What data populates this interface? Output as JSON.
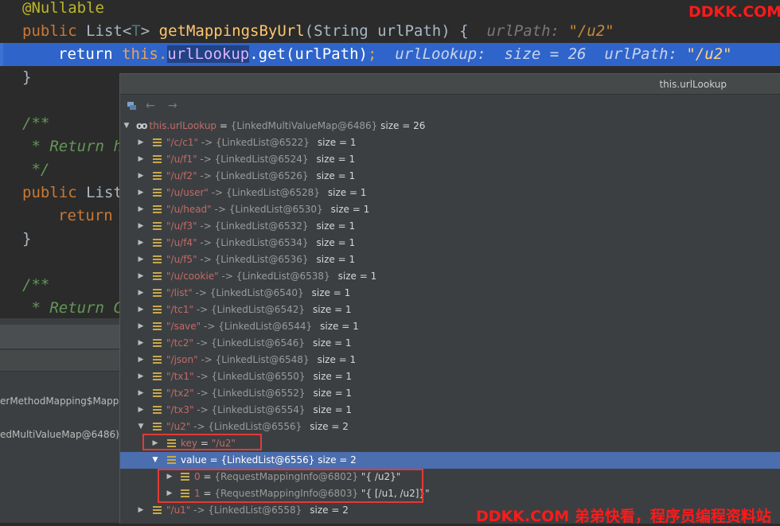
{
  "editor": {
    "line1": "@Nullable",
    "line2": {
      "public": "public ",
      "type": "List<",
      "tparam": "T",
      "close": "> ",
      "method": "getMappingsByUrl",
      "params": "(String urlPath) {  ",
      "hint_label": "urlPath: ",
      "hint_value": "\"/u2\""
    },
    "line3": {
      "ret": "return ",
      "this": "this.",
      "field": "urlLookup",
      "rest": ".get(urlPath)",
      "semi": ";  ",
      "hint1": "urlLookup:  size = 26  ",
      "hint2_label": "urlPath: ",
      "hint2_value": "\"/u2\""
    },
    "line4": "}",
    "line6": "/**",
    "line7": " * Return h",
    "line8": " */",
    "line9": {
      "public": "public ",
      "type": "List"
    },
    "line10": "return",
    "line11": "}",
    "line13": "/**",
    "line14": " * Return C"
  },
  "debug_frames": [
    "erMethodMapping$Mapp",
    "edMultiValueMap@6486)"
  ],
  "popup": {
    "title": "this.urlLookup",
    "toolbar": {
      "back": "←",
      "forward": "→"
    },
    "root": {
      "name": "this.urlLookup",
      "eq": " = ",
      "ref": "{LinkedMultiValueMap@6486}",
      "size": "  size = 26"
    },
    "entries": [
      {
        "key": "\"/c/c1\"",
        "ref": "{LinkedList@6522}",
        "size": "size = 1"
      },
      {
        "key": "\"/u/f1\"",
        "ref": "{LinkedList@6524}",
        "size": "size = 1"
      },
      {
        "key": "\"/u/f2\"",
        "ref": "{LinkedList@6526}",
        "size": "size = 1"
      },
      {
        "key": "\"/u/user\"",
        "ref": "{LinkedList@6528}",
        "size": "size = 1"
      },
      {
        "key": "\"/u/head\"",
        "ref": "{LinkedList@6530}",
        "size": "size = 1"
      },
      {
        "key": "\"/u/f3\"",
        "ref": "{LinkedList@6532}",
        "size": "size = 1"
      },
      {
        "key": "\"/u/f4\"",
        "ref": "{LinkedList@6534}",
        "size": "size = 1"
      },
      {
        "key": "\"/u/f5\"",
        "ref": "{LinkedList@6536}",
        "size": "size = 1"
      },
      {
        "key": "\"/u/cookie\"",
        "ref": "{LinkedList@6538}",
        "size": "size = 1"
      },
      {
        "key": "\"/list\"",
        "ref": "{LinkedList@6540}",
        "size": "size = 1"
      },
      {
        "key": "\"/tc1\"",
        "ref": "{LinkedList@6542}",
        "size": "size = 1"
      },
      {
        "key": "\"/save\"",
        "ref": "{LinkedList@6544}",
        "size": "size = 1"
      },
      {
        "key": "\"/tc2\"",
        "ref": "{LinkedList@6546}",
        "size": "size = 1"
      },
      {
        "key": "\"/json\"",
        "ref": "{LinkedList@6548}",
        "size": "size = 1"
      },
      {
        "key": "\"/tx1\"",
        "ref": "{LinkedList@6550}",
        "size": "size = 1"
      },
      {
        "key": "\"/tx2\"",
        "ref": "{LinkedList@6552}",
        "size": "size = 1"
      },
      {
        "key": "\"/tx3\"",
        "ref": "{LinkedList@6554}",
        "size": "size = 1"
      },
      {
        "key": "\"/u2\"",
        "ref": "{LinkedList@6556}",
        "size": "size = 2"
      }
    ],
    "u2_children": {
      "key_row": {
        "name": "key",
        "eq": " = ",
        "val": "\"/u2\""
      },
      "value_row": {
        "name": "value",
        "eq": " = ",
        "ref": "{LinkedList@6556}",
        "size": "  size = 2"
      },
      "items": [
        {
          "idx": "0",
          "eq": " = ",
          "ref": "{RequestMappingInfo@6802}",
          "val": " \"{ /u2}\""
        },
        {
          "idx": "1",
          "eq": " = ",
          "ref": "{RequestMappingInfo@6803}",
          "val": " \"{ [/u1, /u2]}\""
        }
      ]
    },
    "last_entry": {
      "key": "\"/u1\"",
      "ref": "{LinkedList@6558}",
      "size": "size = 2"
    },
    "arrow_sep": " -> "
  },
  "watermarks": {
    "top": "DDKK.COM",
    "bottom": "DDKK.COM 弟弟快看，程序员编程资料站"
  },
  "colors": {
    "selection": "#4b6eaf",
    "current_line": "#2f65ca",
    "watermark": "#ff1a1a",
    "highlight_box": "#e53935"
  }
}
